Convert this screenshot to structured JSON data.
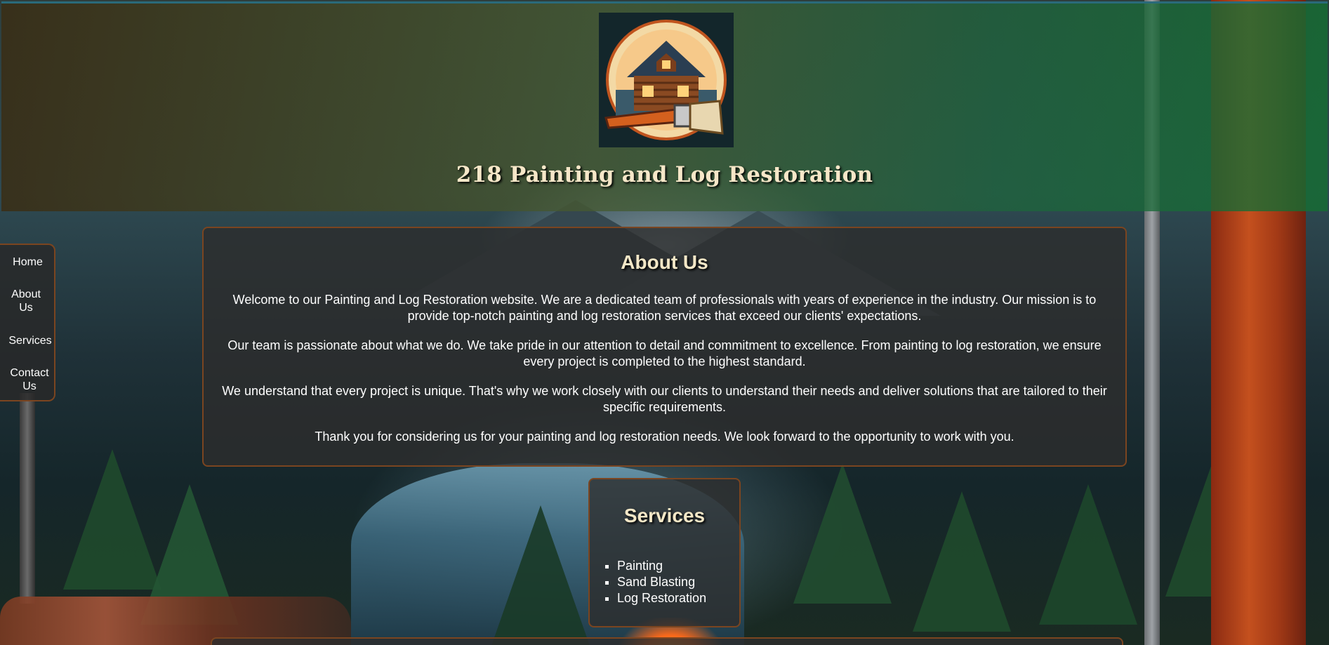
{
  "header": {
    "title": "218 Painting and Log Restoration",
    "logo_icon": "log-cabin-paintbrush-logo"
  },
  "nav": {
    "items": [
      {
        "label": "Home"
      },
      {
        "label": "About Us"
      },
      {
        "label": "Services"
      },
      {
        "label": "Contact Us"
      }
    ]
  },
  "about": {
    "heading": "About Us",
    "paragraphs": [
      "Welcome to our Painting and Log Restoration website. We are a dedicated team of professionals with years of experience in the industry. Our mission is to provide top-notch painting and log restoration services that exceed our clients' expectations.",
      "Our team is passionate about what we do. We take pride in our attention to detail and commitment to excellence. From painting to log restoration, we ensure every project is completed to the highest standard.",
      "We understand that every project is unique. That's why we work closely with our clients to understand their needs and deliver solutions that are tailored to their specific requirements.",
      "Thank you for considering us for your painting and log restoration needs. We look forward to the opportunity to work with you."
    ]
  },
  "services": {
    "heading": "Services",
    "items": [
      "Painting",
      "Sand Blasting",
      "Log Restoration"
    ]
  },
  "colors": {
    "panel_border": "#7b4520",
    "heading_text": "#f3e7c7",
    "panel_bg": "#2d2d2d"
  }
}
